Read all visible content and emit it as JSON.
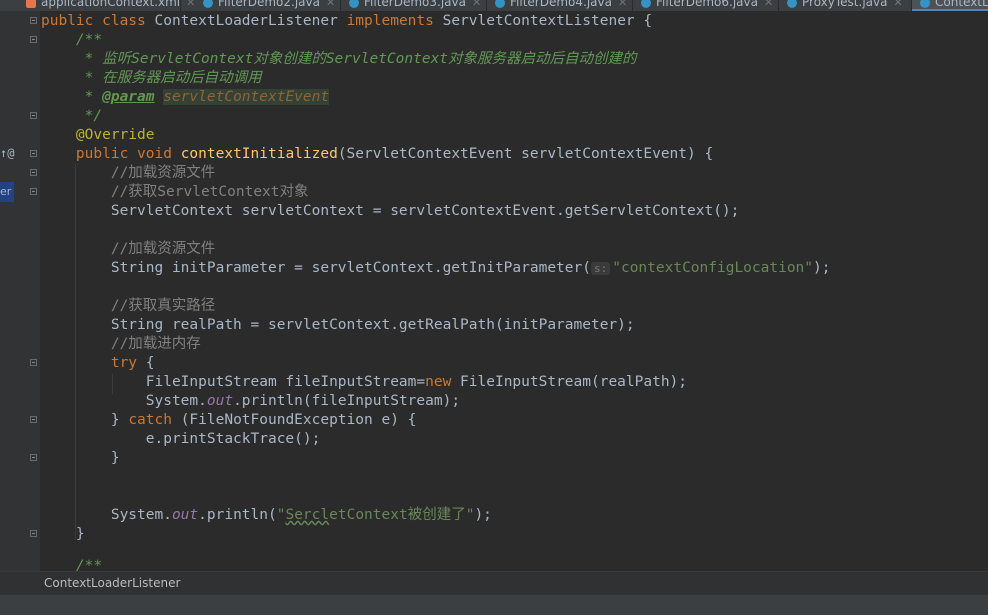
{
  "tabs": [
    {
      "label": "applicationContext.xml",
      "type": "xml"
    },
    {
      "label": "FilterDemo2.java",
      "type": "java"
    },
    {
      "label": "FilterDemo3.java",
      "type": "java"
    },
    {
      "label": "FilterDemo4.java",
      "type": "java"
    },
    {
      "label": "FilterDemo6.java",
      "type": "java"
    },
    {
      "label": "ProxyTest.java",
      "type": "java"
    },
    {
      "label": "ContextL",
      "type": "java",
      "active": true
    }
  ],
  "gutter": {
    "override_mark": "↑@",
    "side_label": "er"
  },
  "code": {
    "l1": {
      "kw1": "public class ",
      "cls": "ContextLoaderListener ",
      "kw2": "implements ",
      "iface": "ServletContextListener {"
    },
    "l2": "    /**",
    "l3": "     * 监听ServletContext对象创建的ServletContext对象服务器启动后自动创建的",
    "l4": "     * 在服务器启动后自动调用",
    "l5": {
      "prefix": "     * ",
      "tag": "@param",
      "sp": " ",
      "param": "servletContextEvent"
    },
    "l6": "     */",
    "l7": "    @Override",
    "l8": {
      "kw": "    public void ",
      "fn": "contextInitialized",
      "rest": "(ServletContextEvent servletContextEvent) {"
    },
    "l9": "        //加载资源文件",
    "l10": "        //获取ServletContext对象",
    "l11": "        ServletContext servletContext = servletContextEvent.getServletContext();",
    "l12": "        //加载资源文件",
    "l13": {
      "pre": "        String initParameter = servletContext.getInitParameter(",
      "hint": "s:",
      "str": "\"contextConfigLocation\"",
      "post": ");"
    },
    "l14": "        //获取真实路径",
    "l15": "        String realPath = servletContext.getRealPath(initParameter);",
    "l16": "        //加载进内存",
    "l17": {
      "kw": "        try",
      "rest": " {"
    },
    "l18": {
      "pre": "            FileInputStream fileInputStream=",
      "kw": "new",
      "post": " FileInputStream(realPath);"
    },
    "l19": {
      "pre": "            System.",
      "fld": "out",
      "post": ".println(fileInputStream);"
    },
    "l20": {
      "pre": "        } ",
      "kw": "catch",
      "post": " (FileNotFoundException e) {"
    },
    "l21": "            e.printStackTrace();",
    "l22": "        }",
    "l23": {
      "pre": "        System.",
      "fld": "out",
      "mid": ".println(",
      "q1": "\"",
      "sq": "Sercl",
      "str": "etContext被创建了\"",
      "post": ");"
    },
    "l24": "    }",
    "l25": "    /**"
  },
  "statusbar": {
    "breadcrumb": "ContextLoaderListener"
  }
}
